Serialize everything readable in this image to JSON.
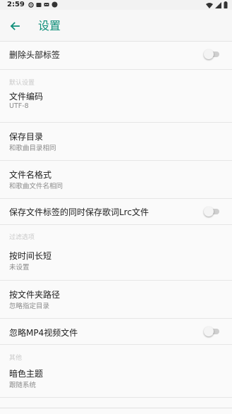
{
  "status_bar": {
    "time": "2:59",
    "left_icons": [
      "settings-icon",
      "notification-icon",
      "chat-icon",
      "circle-icon"
    ],
    "right_icons": [
      "wifi-icon",
      "signal-icon",
      "battery-icon"
    ]
  },
  "toolbar": {
    "back_icon": "arrow-back-icon",
    "title": "设置",
    "accent_color": "#0f8f7a"
  },
  "items": {
    "remove_header_tag": {
      "title": "删除头部标签",
      "switch_on": false
    },
    "cat1": "默认设置",
    "file_encoding": {
      "title": "文件编码",
      "summary": "UTF-8"
    },
    "save_dir": {
      "title": "保存目录",
      "summary": "和歌曲目录相同"
    },
    "filename_format": {
      "title": "文件名格式",
      "summary": "和歌曲文件名相同"
    },
    "save_lrc": {
      "title": "保存文件标签的同时保存歌词Lrc文件",
      "switch_on": false
    },
    "cat2": "过滤选项",
    "by_duration": {
      "title": "按时间长短",
      "summary": "未设置"
    },
    "by_folder": {
      "title": "按文件夹路径",
      "summary": "忽略指定目录"
    },
    "ignore_mp4": {
      "title": "忽略MP4视频文件",
      "switch_on": false
    },
    "cat3": "其他",
    "dark_theme": {
      "title": "暗色主题",
      "summary": "跟随系统"
    }
  }
}
